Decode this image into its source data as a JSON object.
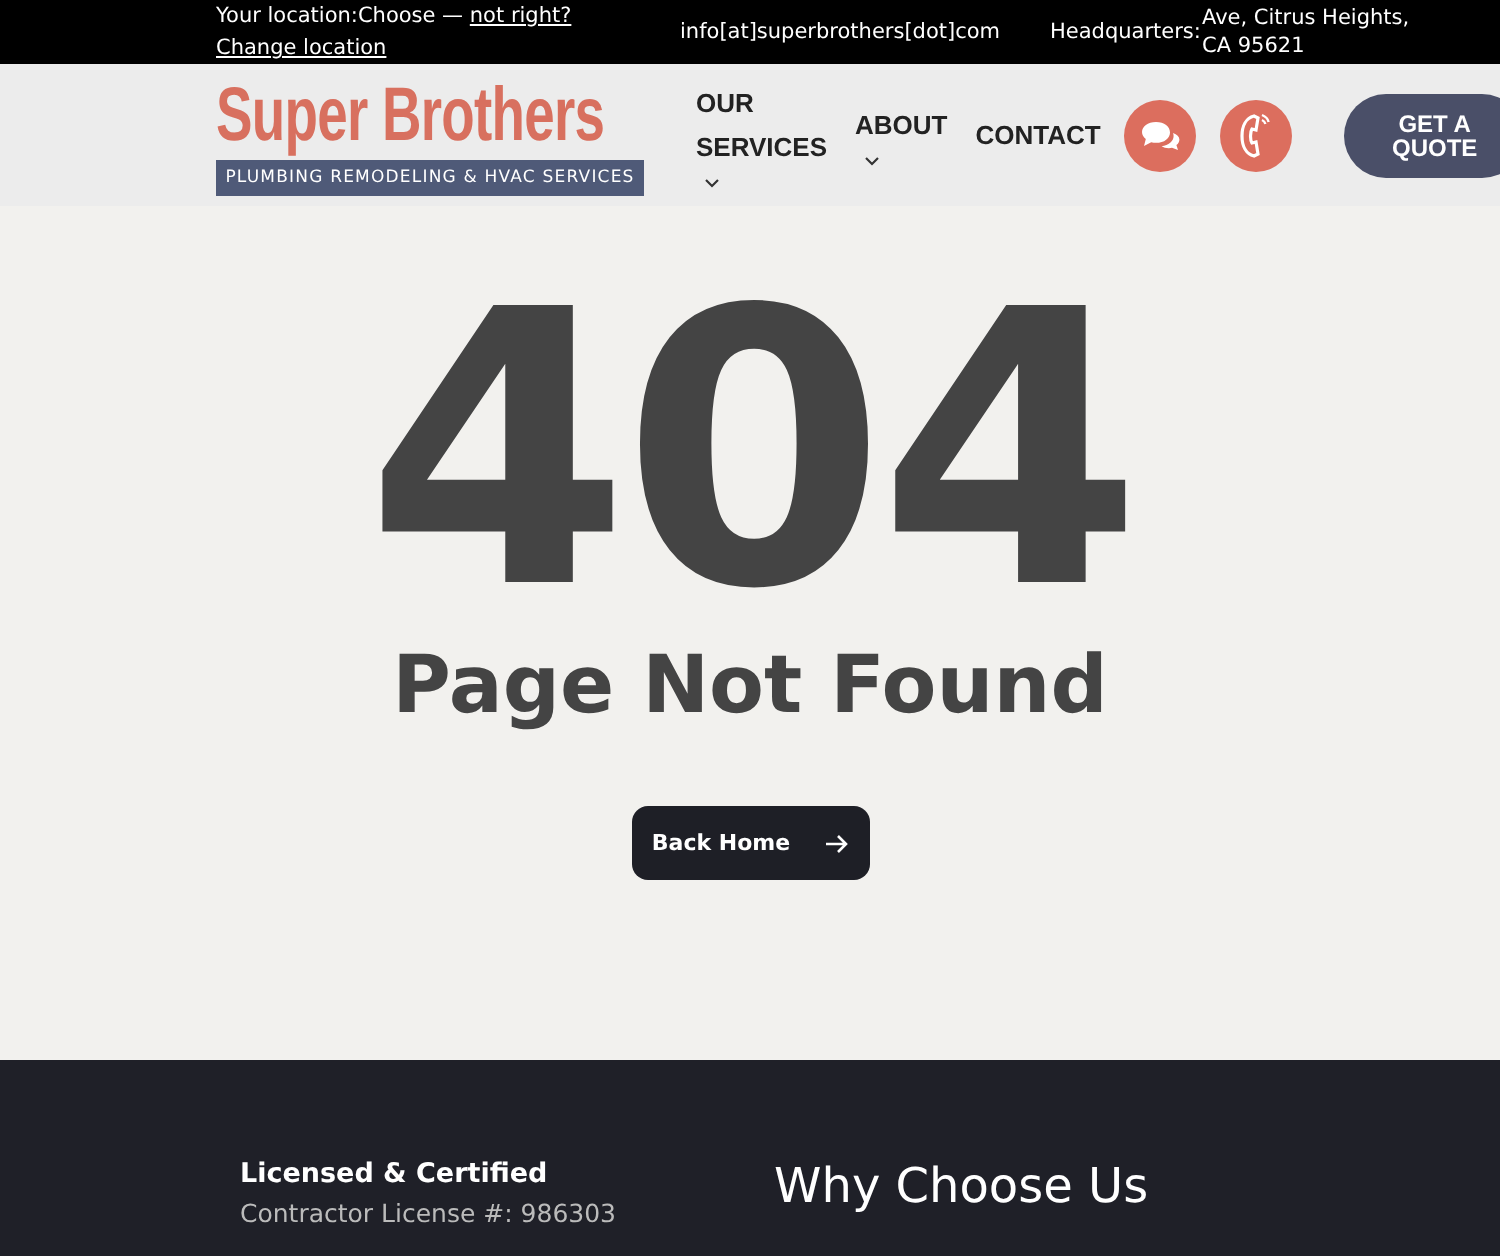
{
  "top_bar": {
    "location_text": "Your location:Choose — ",
    "location_link": "not right?",
    "change_link": "Change location",
    "email": "info[at]superbrothers[dot]com",
    "hq_label": "Headquarters:",
    "hq_address": "Ave, Citrus Heights, CA 95621"
  },
  "logo": {
    "title": "Super Brothers",
    "tagline": "PLUMBING REMODELING & HVAC SERVICES"
  },
  "nav": {
    "items": [
      {
        "label": "OUR SERVICES",
        "dropdown": true
      },
      {
        "label": "ABOUT",
        "dropdown": true
      },
      {
        "label": "CONTACT",
        "dropdown": false
      }
    ],
    "cta": "GET A QUOTE"
  },
  "error": {
    "code": "404",
    "title": "Page Not Found",
    "button": "Back Home"
  },
  "footer": {
    "license_title": "Licensed & Certified",
    "license_text": "Contractor License #: 986303",
    "heading": "Why Choose Us"
  }
}
